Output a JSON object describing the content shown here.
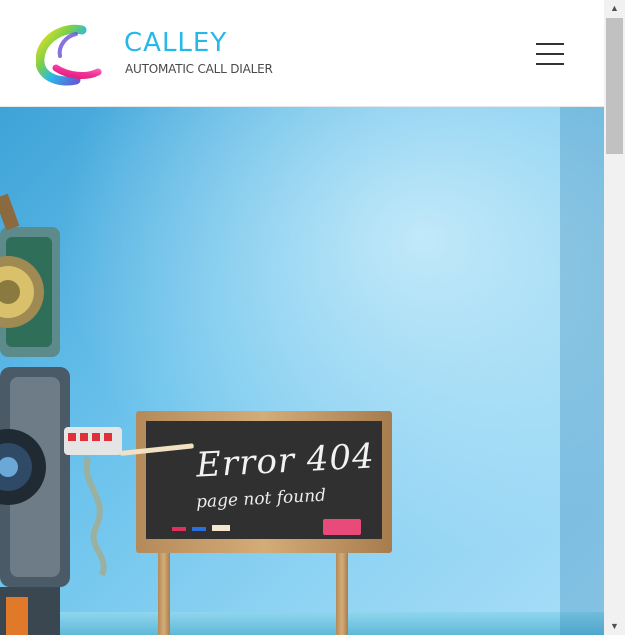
{
  "brand": {
    "name": "CALLEY",
    "tagline": "AUTOMATIC CALL DIALER",
    "colors": {
      "primary": "#27b7e8",
      "tagline": "#4a4a4a"
    }
  },
  "header": {
    "menu_icon": "hamburger-icon"
  },
  "hero": {
    "board_title": "Error 404",
    "board_subtitle": "page not found",
    "background_color": "#6cc3ec"
  },
  "scrollbar": {
    "up_icon": "▲",
    "down_icon": "▼",
    "position_fraction": 0
  }
}
